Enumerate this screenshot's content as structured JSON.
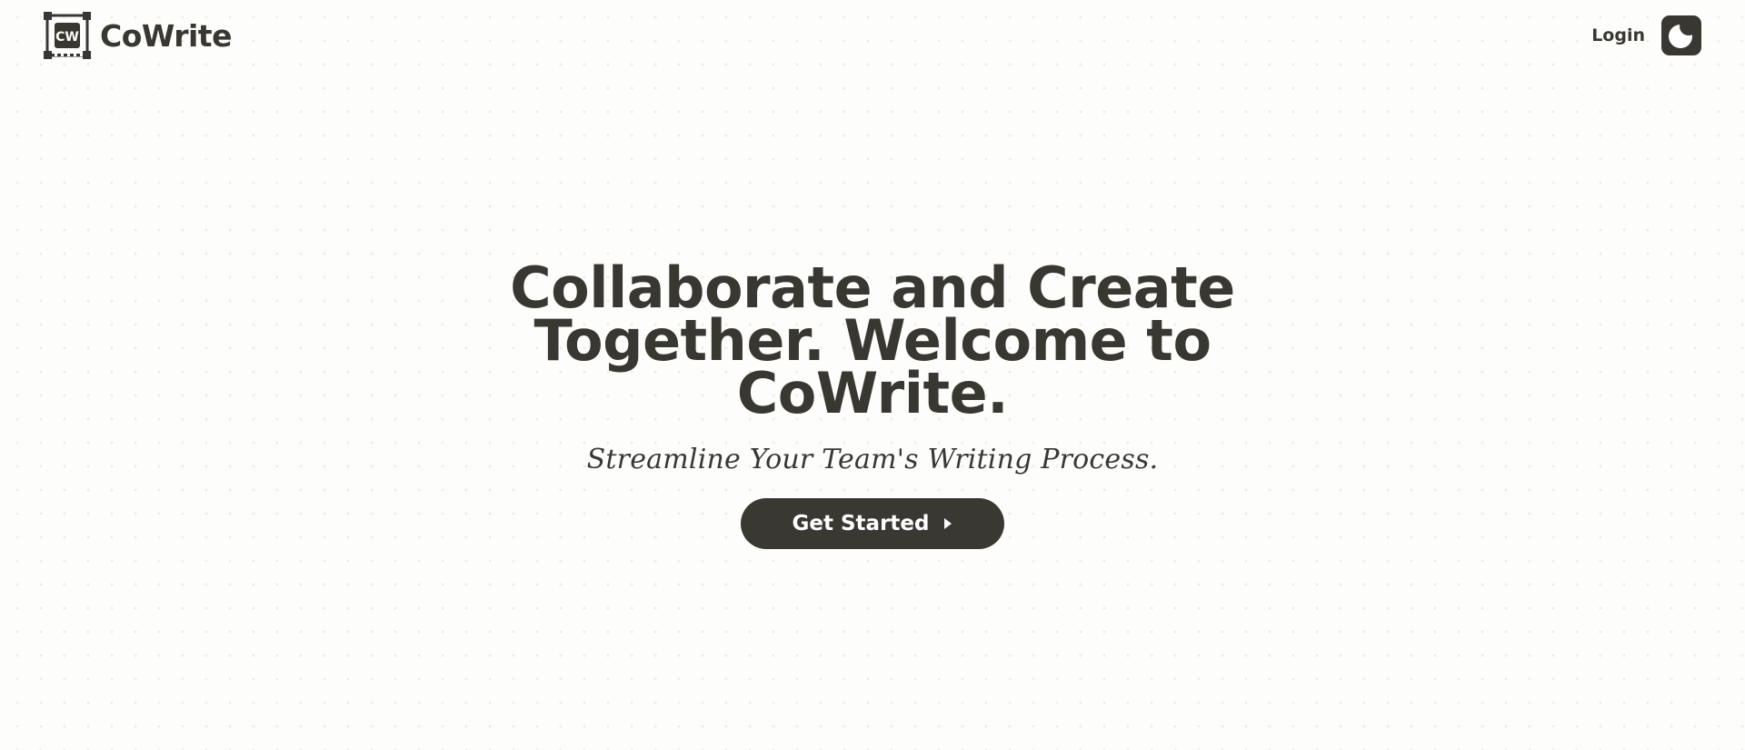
{
  "header": {
    "brand_name": "CoWrite",
    "logo_text": "CW",
    "login_label": "Login",
    "theme_icon": "moon-icon"
  },
  "hero": {
    "title_lines": [
      "Collaborate and Create",
      "Together. Welcome to",
      "CoWrite."
    ],
    "subtitle": "Streamline Your Team's Writing Process.",
    "cta_label": "Get Started",
    "cta_icon": "caret-right-icon"
  },
  "colors": {
    "text": "#393732",
    "button_bg": "#3a3833",
    "page_bg": "#fdfdfc",
    "dot_pattern": "#ececea"
  }
}
